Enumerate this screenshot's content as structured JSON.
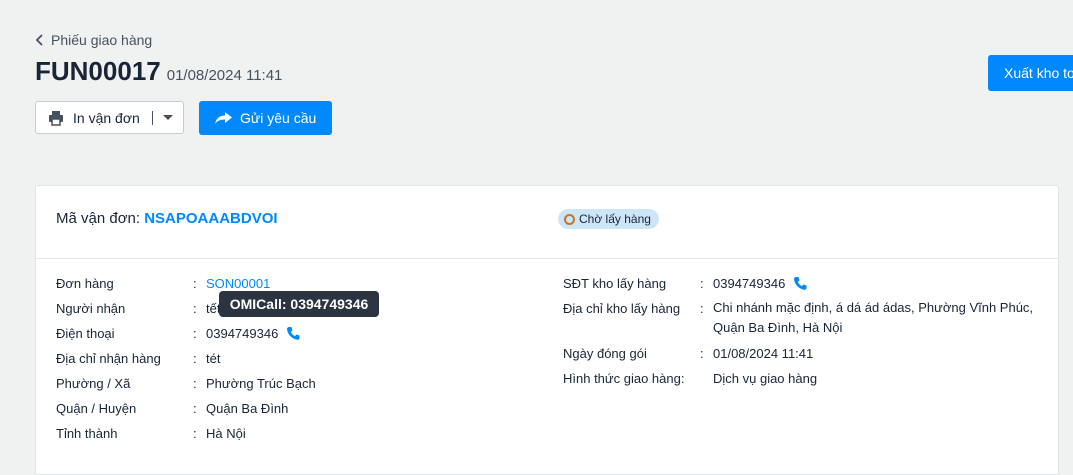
{
  "breadcrumb": {
    "label": "Phiếu giao hàng"
  },
  "header": {
    "title": "FUN00017",
    "datetime": "01/08/2024 11:41",
    "export_label": "Xuất kho to"
  },
  "toolbar": {
    "print_label": "In vận đơn",
    "send_label": "Gửi yêu cầu"
  },
  "card": {
    "tracking_label": "Mã vận đơn: ",
    "tracking_code": "NSAPOAAABDVOI",
    "status": "Chờ lấy hàng"
  },
  "colon": ":",
  "left": [
    {
      "key": "Đơn hàng",
      "value": "SON00001"
    },
    {
      "key": "Người nhận",
      "value": "tết"
    },
    {
      "key": "Điện thoại",
      "value": "0394749346"
    },
    {
      "key": "Địa chỉ nhận hàng",
      "value": "tét"
    },
    {
      "key": "Phường / Xã",
      "value": "Phường Trúc Bạch"
    },
    {
      "key": "Quận / Huyện",
      "value": "Quận Ba Đình"
    },
    {
      "key": "Tỉnh thành",
      "value": "Hà Nội"
    }
  ],
  "right": [
    {
      "key": "SĐT kho lấy hàng",
      "value": "0394749346"
    },
    {
      "key": "Địa chỉ kho lấy hàng",
      "value": "Chi nhánh mặc định, á dá ád ádas, Phường Vĩnh Phúc, Quận Ba Đình, Hà Nội"
    },
    {
      "key": "Ngày đóng gói",
      "value": "01/08/2024 11:41"
    },
    {
      "key": "Hình thức giao hàng:",
      "value": "Dịch vụ giao hàng"
    }
  ],
  "tooltip": {
    "text": "OMICall: 0394749346"
  },
  "colors": {
    "primary": "#0088ff",
    "badge_bg": "#cde6f7",
    "badge_ring": "#c0762a",
    "tooltip_bg": "#2b3440"
  }
}
